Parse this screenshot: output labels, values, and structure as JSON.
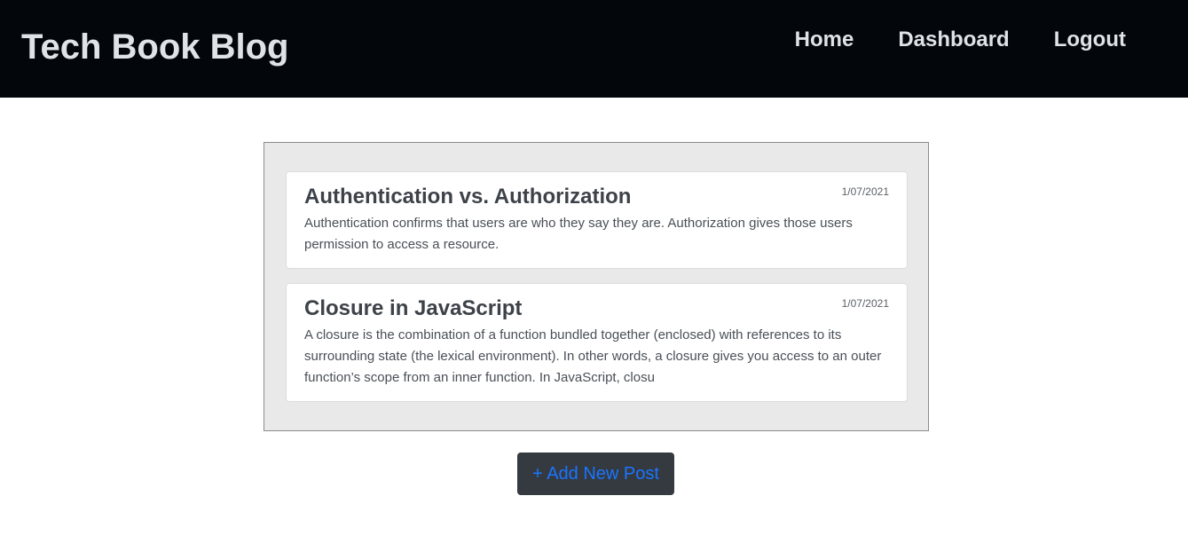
{
  "header": {
    "brand": "Tech Book Blog",
    "nav": [
      {
        "label": "Home"
      },
      {
        "label": "Dashboard"
      },
      {
        "label": "Logout"
      }
    ]
  },
  "posts": [
    {
      "title": "Authentication vs. Authorization",
      "date": "1/07/2021",
      "body": "Authentication confirms that users are who they say they are. Authorization gives those users permission to access a resource."
    },
    {
      "title": "Closure in JavaScript",
      "date": "1/07/2021",
      "body": "A closure is the combination of a function bundled together (enclosed) with references to its surrounding state (the lexical environment). In other words, a closure gives you access to an outer function’s scope from an inner function. In JavaScript, closu"
    }
  ],
  "actions": {
    "add_post_label": "+ Add New Post"
  },
  "colors": {
    "navbar_bg": "#03060b",
    "button_bg": "#343a40",
    "button_text": "#1a75ff"
  }
}
